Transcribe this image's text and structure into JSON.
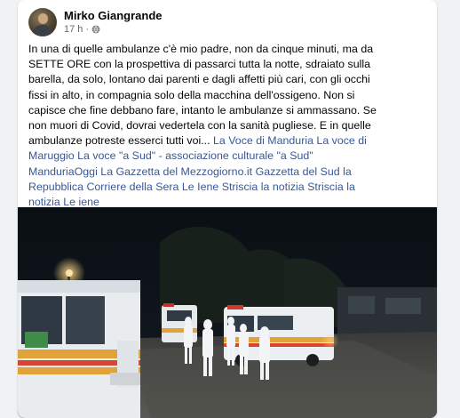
{
  "post": {
    "author": "Mirko Giangrande",
    "time": "17 h",
    "separator": "·",
    "audience_icon": "globe-icon",
    "text_main": "In una di quelle ambulanze c'è mio padre, non da cinque minuti, ma da SETTE ORE con la prospettiva di passarci tutta la notte, sdraiato sulla barella, da solo, lontano dai parenti e dagli affetti più cari, con gli occhi fissi in alto, in compagnia solo della macchina dell'ossigeno. Non si capisce che fine debbano fare, intanto le ambulanze si ammassano. Se non muori di Covid, dovrai vedertela con la sanità pugliese. E in quelle ambulanze potreste esserci tutti voi...",
    "tags": [
      "La Voce di Manduria",
      "La voce di Maruggio",
      "La voce \"a Sud\" - associazione culturale \"a Sud\"",
      "ManduriaOggi",
      "La Gazzetta del Mezzogiorno.it",
      "Gazzetta del Sud",
      "la Repubblica",
      "Corriere della Sera",
      "Le Iene",
      "Striscia la notizia",
      "Striscia la notizia",
      "Le iene"
    ]
  },
  "media": {
    "description_icon": "photo-ambulances-night"
  },
  "colors": {
    "link": "#385898",
    "text": "#050505",
    "secondary": "#65676b",
    "background": "#f0f2f5"
  }
}
